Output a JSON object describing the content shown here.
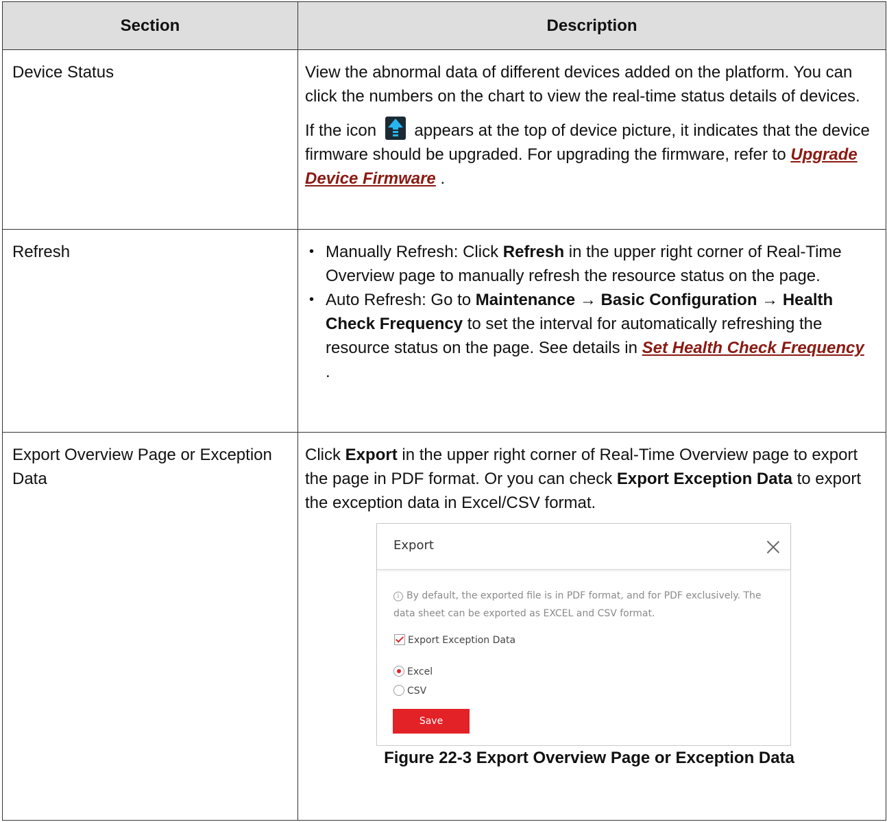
{
  "table": {
    "headers": {
      "section": "Section",
      "description": "Description"
    },
    "rows": {
      "device_status": {
        "section": "Device Status",
        "p1": "View the abnormal data of different devices added on the platform. You can click the numbers on the chart to view the real-time status details of devices.",
        "p2_before_icon": "If the icon",
        "p2_after_icon": "appears at the top of device picture, it indicates that the device firmware should be upgraded. For upgrading the firmware, refer to",
        "p2_link": "Upgrade Device Firmware",
        "p2_end": " ."
      },
      "refresh": {
        "section": "Refresh",
        "b1_pre": "Manually Refresh: Click ",
        "b1_bold": "Refresh",
        "b1_post": " in the upper right corner of Real-Time Overview page to manually refresh the resource status on the page.",
        "b2_pre": "Auto Refresh: Go to ",
        "b2_bold": "Maintenance → Basic Configuration → Health Check Frequency",
        "b2_post": " to set the interval for automatically refreshing the resource status on the page. See details in ",
        "b2_link": "Set Health Check Frequency",
        "b2_end": " ."
      },
      "export": {
        "section": "Export Overview Page or Exception Data",
        "p_pre": "Click ",
        "p_bold1": "Export",
        "p_mid": " in the upper right corner of Real-Time Overview page to export the page in PDF format. Or you can check ",
        "p_bold2": "Export Exception Data",
        "p_post": " to export the exception data in Excel/CSV format.",
        "caption": "Figure 22-3 Export Overview Page or Exception Data"
      }
    }
  },
  "dialog": {
    "title": "Export",
    "note": "By default, the exported file is in PDF format, and for PDF exclusively. The data sheet can be exported as EXCEL and CSV format.",
    "checkbox_label": "Export Exception Data",
    "options": [
      "Excel",
      "CSV"
    ],
    "selected": "Excel",
    "save_label": "Save",
    "accent_color": "#e32227"
  },
  "colors": {
    "header_bg": "#dedede",
    "link": "#8a1a12",
    "icon_blue": "#27b5f0"
  },
  "icons": {
    "upgrade": "arrow-up-icon",
    "close": "close-icon",
    "info": "info-icon"
  }
}
